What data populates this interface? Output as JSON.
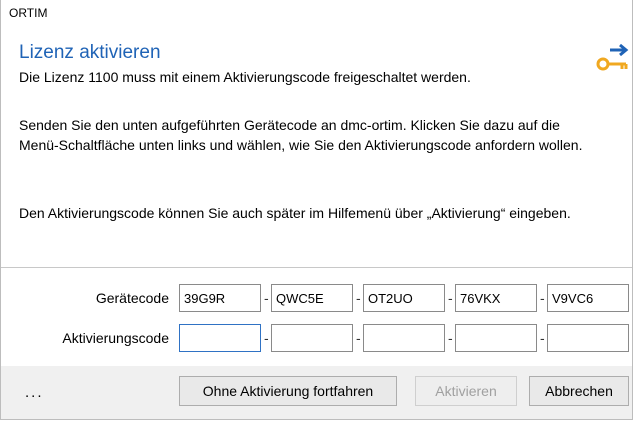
{
  "window": {
    "title": "ORTIM"
  },
  "header": {
    "title": "Lizenz aktivieren",
    "subtitle": "Die Lizenz 1100 muss mit einem Aktivierungscode freigeschaltet werden.",
    "icon": "key-arrow-icon"
  },
  "body": {
    "paragraph1": "Senden Sie den unten aufgeführten Gerätecode an dmc-ortim. Klicken Sie dazu auf die Menü-Schaltfläche unten links und wählen, wie Sie den Aktivierungscode anfordern wollen.",
    "paragraph2": "Den Aktivierungscode können Sie auch später im Hilfemenü über „Aktivierung“ eingeben."
  },
  "device_code": {
    "label": "Gerätecode",
    "parts": [
      "39G9R",
      "QWC5E",
      "OT2UO",
      "76VKX",
      "V9VC6"
    ]
  },
  "activation_code": {
    "label": "Aktivierungscode",
    "parts": [
      "",
      "",
      "",
      "",
      ""
    ]
  },
  "separator": "-",
  "footer": {
    "menu_label": "...",
    "continue_label": "Ohne Aktivierung fortfahren",
    "activate_label": "Aktivieren",
    "cancel_label": "Abbrechen"
  },
  "colors": {
    "heading": "#1f63b6",
    "icon_arrow": "#1f63b6",
    "icon_key": "#f0a820",
    "focus": "#2f72c4"
  }
}
